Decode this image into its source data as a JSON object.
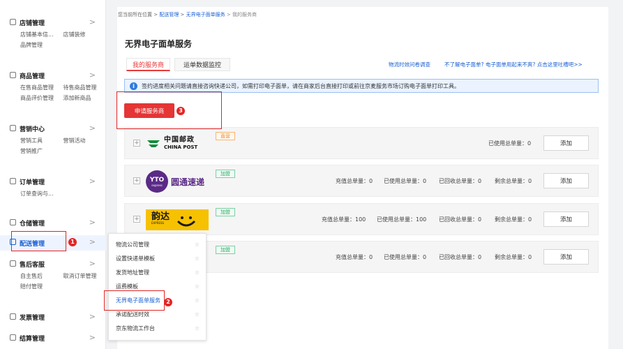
{
  "sidebar": {
    "sections": [
      {
        "title": "店铺管理",
        "links": [
          "店铺基本信...",
          "店铺装修",
          "品牌管理"
        ]
      },
      {
        "title": "商品管理",
        "links": [
          "在售商品管理",
          "待售商品管理",
          "商品评价管理",
          "添加新商品"
        ]
      },
      {
        "title": "营销中心",
        "links": [
          "营销工具",
          "营销活动",
          "营销推广"
        ]
      },
      {
        "title": "订单管理",
        "links": [
          "订单查询与..."
        ]
      },
      {
        "title": "仓储管理",
        "links": []
      },
      {
        "title": "配送管理",
        "links": []
      },
      {
        "title": "售后客服",
        "links": [
          "自主售后",
          "取消订单管理",
          "赔付管理"
        ]
      },
      {
        "title": "发票管理",
        "links": []
      },
      {
        "title": "结算管理",
        "links": []
      }
    ]
  },
  "flyout": {
    "items": [
      "物流公司管理",
      "设置快递单模板",
      "发货地址管理",
      "运费模板",
      "无界电子面单服务",
      "承诺配送时效",
      "京东物流工作台"
    ]
  },
  "badges": {
    "one": "1",
    "two": "2",
    "three": "3"
  },
  "breadcrumb": {
    "prefix": "您当前所在位置 > ",
    "l1": "配送管理",
    "sep": " > ",
    "l2": "无界电子面单服务",
    "current": " > 我的服务商"
  },
  "page": {
    "title": "无界电子面单服务",
    "tabs": [
      "我的服务商",
      "运单数据监控"
    ],
    "links": {
      "survey": "物流时效问卷调查",
      "help": "不了解电子面单? 电子面单用起来不爽? 点击这里吐槽吧>>"
    },
    "notice": "签约进度相关问题请直接咨询快递公司，如需打印电子面单，请在商家后台直接打印或前往京麦服务市场订购电子面单打印工具。",
    "apply_button": "申请服务商"
  },
  "providers": [
    {
      "name": "中国邮政",
      "name_en": "CHINA POST",
      "tag": "直营",
      "stats": [
        "已使用总单量：0"
      ],
      "button": "添加"
    },
    {
      "name": "圆通速递",
      "logo_text": "YTO",
      "logo_sub": "express",
      "tag": "加盟",
      "stats": [
        "充值总单量：0",
        "已使用总单量：0",
        "已回收总单量：0",
        "剩余总单量：0"
      ],
      "button": "添加"
    },
    {
      "name": "韵达",
      "logo_sub": "EXPRESS",
      "tag": "加盟",
      "stats": [
        "充值总单量：100",
        "已使用总单量：100",
        "已回收总单量：0",
        "剩余总单量：0"
      ],
      "button": "添加"
    },
    {
      "name": "",
      "tag": "加盟",
      "stats": [
        "充值总单量：0",
        "已使用总单量：0",
        "已回收总单量：0",
        "剩余总单量：0"
      ],
      "button": "添加"
    }
  ],
  "colors": {
    "accent": "#e53535",
    "link": "#1a5fd0",
    "annotation": "#e02424"
  }
}
